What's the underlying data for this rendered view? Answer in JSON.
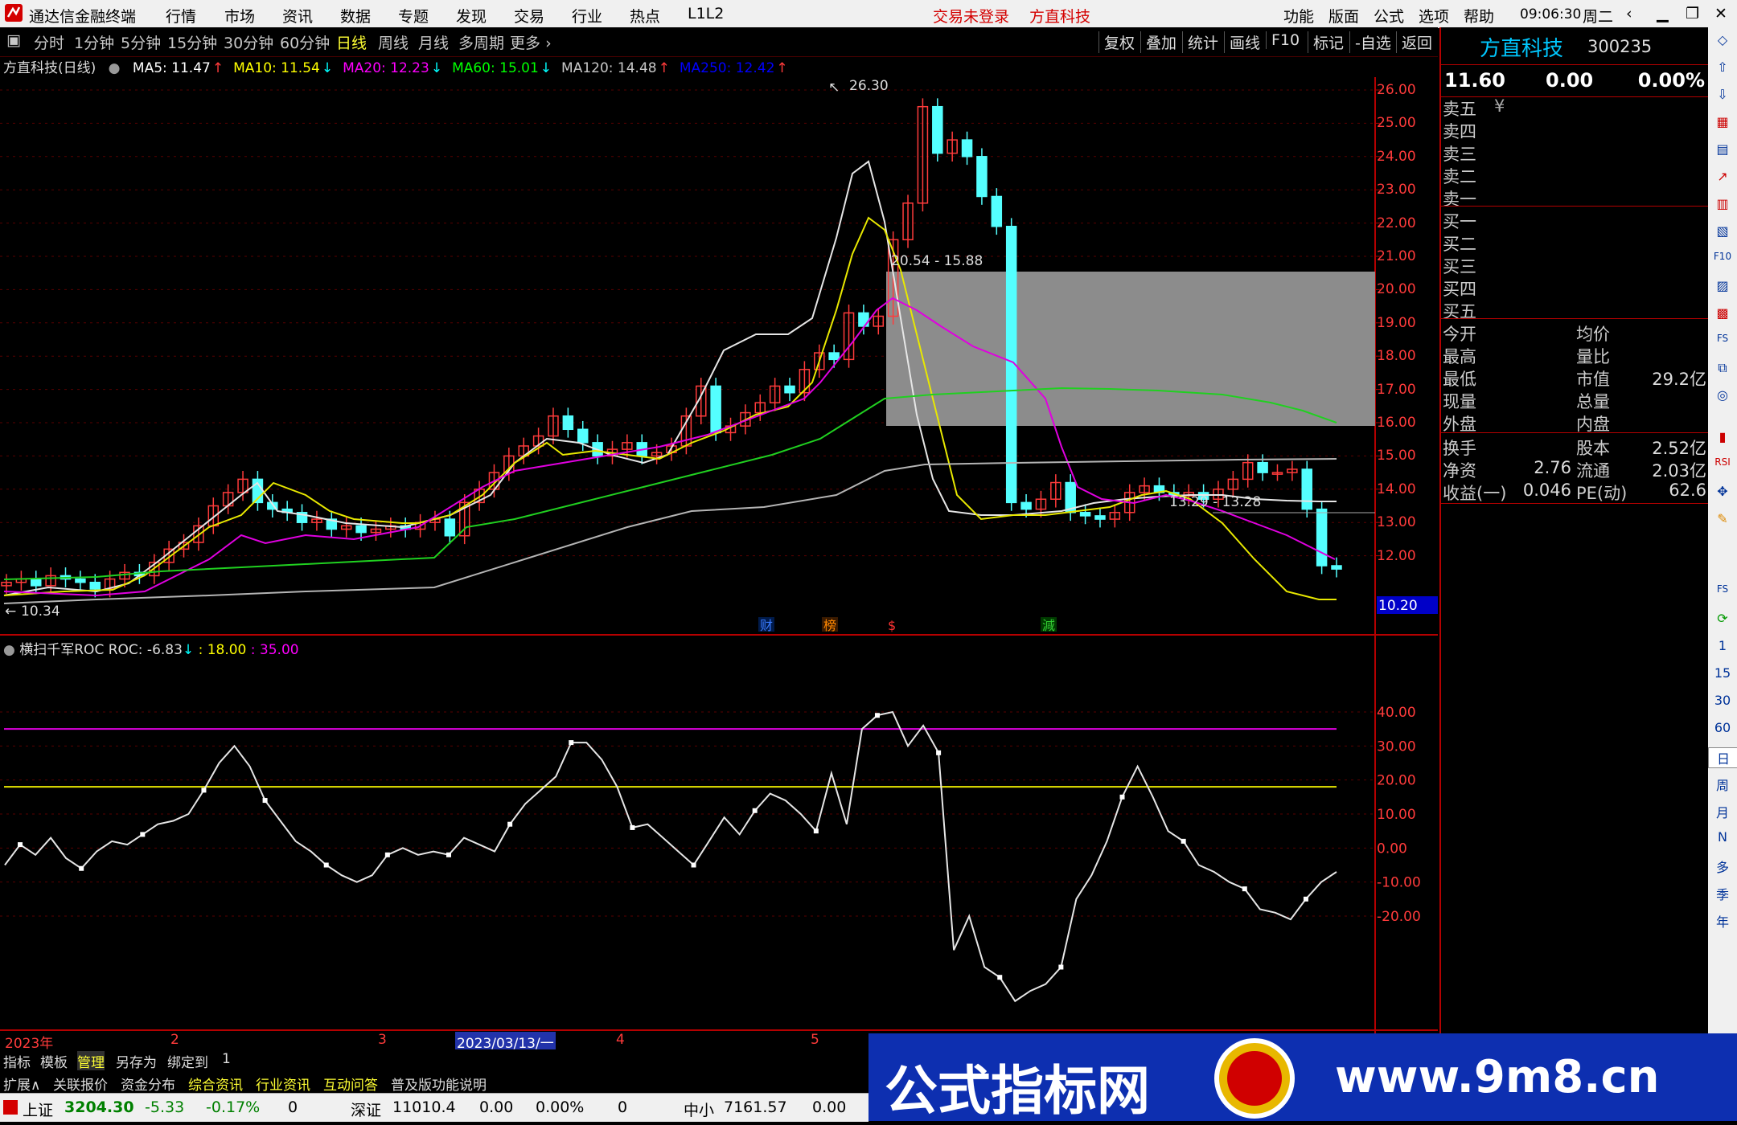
{
  "app": {
    "title": "通达信金融终端",
    "menu": [
      "行情",
      "市场",
      "资讯",
      "数据",
      "专题",
      "发现",
      "交易",
      "行业",
      "热点",
      "L1L2"
    ],
    "login_status": "交易未登录",
    "stock_title": "方直科技",
    "right_menu": [
      "功能",
      "版面",
      "公式",
      "选项",
      "帮助"
    ],
    "time": "09:06:30",
    "weekday": "周二"
  },
  "toolbar": {
    "periods": [
      "分时",
      "1分钟",
      "5分钟",
      "15分钟",
      "30分钟",
      "60分钟",
      "日线",
      "周线",
      "月线",
      "多周期",
      "更多"
    ],
    "active_period": "日线",
    "more_label": "更多",
    "buttons": [
      "复权",
      "叠加",
      "统计",
      "画线",
      "F10",
      "标记",
      "-自选",
      "返回"
    ]
  },
  "main_chart": {
    "title": "方直科技(日线)",
    "ma_labels": [
      {
        "text": "MA5: 11.47",
        "color": "#ffffff",
        "arrow": "↑",
        "arrow_color": "#ff3b3b"
      },
      {
        "text": "MA10: 11.54",
        "color": "#ffff00",
        "arrow": "↓",
        "arrow_color": "#00ffff"
      },
      {
        "text": "MA20: 12.23",
        "color": "#ff00ff",
        "arrow": "↓",
        "arrow_color": "#00ffff"
      },
      {
        "text": "MA60: 15.01",
        "color": "#00ff00",
        "arrow": "↓",
        "arrow_color": "#00ffff"
      },
      {
        "text": "MA120: 14.48",
        "color": "#c8c8c8",
        "arrow": "↑",
        "arrow_color": "#ff3b3b"
      },
      {
        "text": "MA250: 12.42",
        "color": "#0000ff",
        "arrow": "↑",
        "arrow_color": "#ff3b3b"
      }
    ],
    "y_ticks": [
      "26.00",
      "25.00",
      "24.00",
      "23.00",
      "22.00",
      "21.00",
      "20.00",
      "19.00",
      "18.00",
      "17.00",
      "16.00",
      "15.00",
      "14.00",
      "13.00",
      "12.00"
    ],
    "high_label": "26.30",
    "low_label": "10.34",
    "gap1_label": "20.54 - 15.88",
    "gap2_label": "13.29 - 13.28",
    "current_price_tag": "10.20",
    "event_markers": [
      {
        "text": "财",
        "color": "#3a7bff"
      },
      {
        "text": "榜",
        "color": "#ff8800"
      },
      {
        "text": "$",
        "color": "#ff3333"
      },
      {
        "text": "減",
        "color": "#33cc33"
      }
    ]
  },
  "indicator": {
    "title": "横扫千军ROC",
    "roc_label": "ROC: -6.83",
    "roc_arrow": "↓",
    "level1_label": ": 18.00",
    "level2_label": ": 35.00",
    "level1_color": "#ffff00",
    "level2_color": "#ff00ff",
    "y_ticks": [
      "40.00",
      "30.00",
      "20.00",
      "10.00",
      "0.00",
      "-10.00",
      "-20.00"
    ]
  },
  "chart_data": {
    "type": "line",
    "title": "横扫千军ROC",
    "series": [
      {
        "name": "ROC",
        "values": [
          -5,
          1,
          -2,
          3,
          -3,
          -6,
          -1,
          2,
          1,
          4,
          7,
          8,
          10,
          17,
          25,
          30,
          24,
          14,
          8,
          2,
          -1,
          -5,
          -8,
          -10,
          -8,
          -2,
          0,
          -2,
          -1,
          -2,
          3,
          1,
          -1,
          7,
          13,
          17,
          21,
          31,
          31,
          26,
          18,
          6,
          7,
          3,
          -1,
          -5,
          2,
          9,
          4,
          11,
          16,
          14,
          10,
          5,
          22,
          7,
          35,
          39,
          40,
          30,
          36,
          28,
          -30,
          -20,
          -35,
          -38,
          -45,
          -42,
          -40,
          -35,
          -15,
          -8,
          2,
          15,
          24,
          15,
          5,
          2,
          -5,
          -7,
          -10,
          -12,
          -18,
          -19,
          -21,
          -15,
          -10,
          -7
        ]
      },
      {
        "name": "18.00",
        "values": [
          18
        ]
      },
      {
        "name": "35.00",
        "values": [
          35
        ]
      }
    ],
    "ylim": [
      -50,
      50
    ]
  },
  "time_axis": {
    "labels": [
      "2023年",
      "2",
      "3",
      "2023/03/13/一",
      "4",
      "5"
    ]
  },
  "right_panel": {
    "stock_name": "方直科技",
    "stock_code": "300235",
    "price": "11.60",
    "change": "0.00",
    "pct": "0.00%",
    "sell_levels": [
      "卖五",
      "卖四",
      "卖三",
      "卖二",
      "卖一"
    ],
    "buy_levels": [
      "买一",
      "买二",
      "买三",
      "买四",
      "买五"
    ],
    "stats_left": [
      "今开",
      "最高",
      "最低",
      "现量",
      "外盘"
    ],
    "stats_right": [
      "均价",
      "量比",
      "市值",
      "总量",
      "内盘"
    ],
    "market_value": "29.2亿",
    "fin_left": [
      {
        "label": "换手",
        "value": ""
      },
      {
        "label": "净资",
        "value": "2.76"
      },
      {
        "label": "收益(一)",
        "value": "0.046"
      }
    ],
    "fin_right": [
      {
        "label": "股本",
        "value": "2.52亿"
      },
      {
        "label": "流通",
        "value": "2.03亿"
      },
      {
        "label": "PE(动)",
        "value": "62.6"
      }
    ]
  },
  "sidebar": {
    "items": [
      "1",
      "15",
      "30",
      "60",
      "日",
      "周",
      "月",
      "N",
      "多",
      "季",
      "年"
    ]
  },
  "bottom": {
    "tabs1": [
      "指标",
      "模板",
      "管理",
      "另存为",
      "绑定到",
      "1"
    ],
    "tabs2": [
      "扩展∧",
      "关联报价",
      "资金分布",
      "综合资讯",
      "行业资讯",
      "互动问答",
      "普及版功能说明"
    ],
    "index1_name": "上证",
    "index1_value": "3204.30",
    "index1_change": "-5.33",
    "index1_pct": "-0.17%",
    "index1_vol": "0",
    "index2_name": "深证",
    "index2_value": "11010.4",
    "index2_change": "0.00",
    "index2_pct": "0.00%",
    "index2_vol": "0",
    "index3_name": "中小",
    "index3_value": "7161.57",
    "index3_change": "0.00"
  },
  "banner": {
    "text": "公式指标网",
    "url": "www.9m8.cn"
  }
}
